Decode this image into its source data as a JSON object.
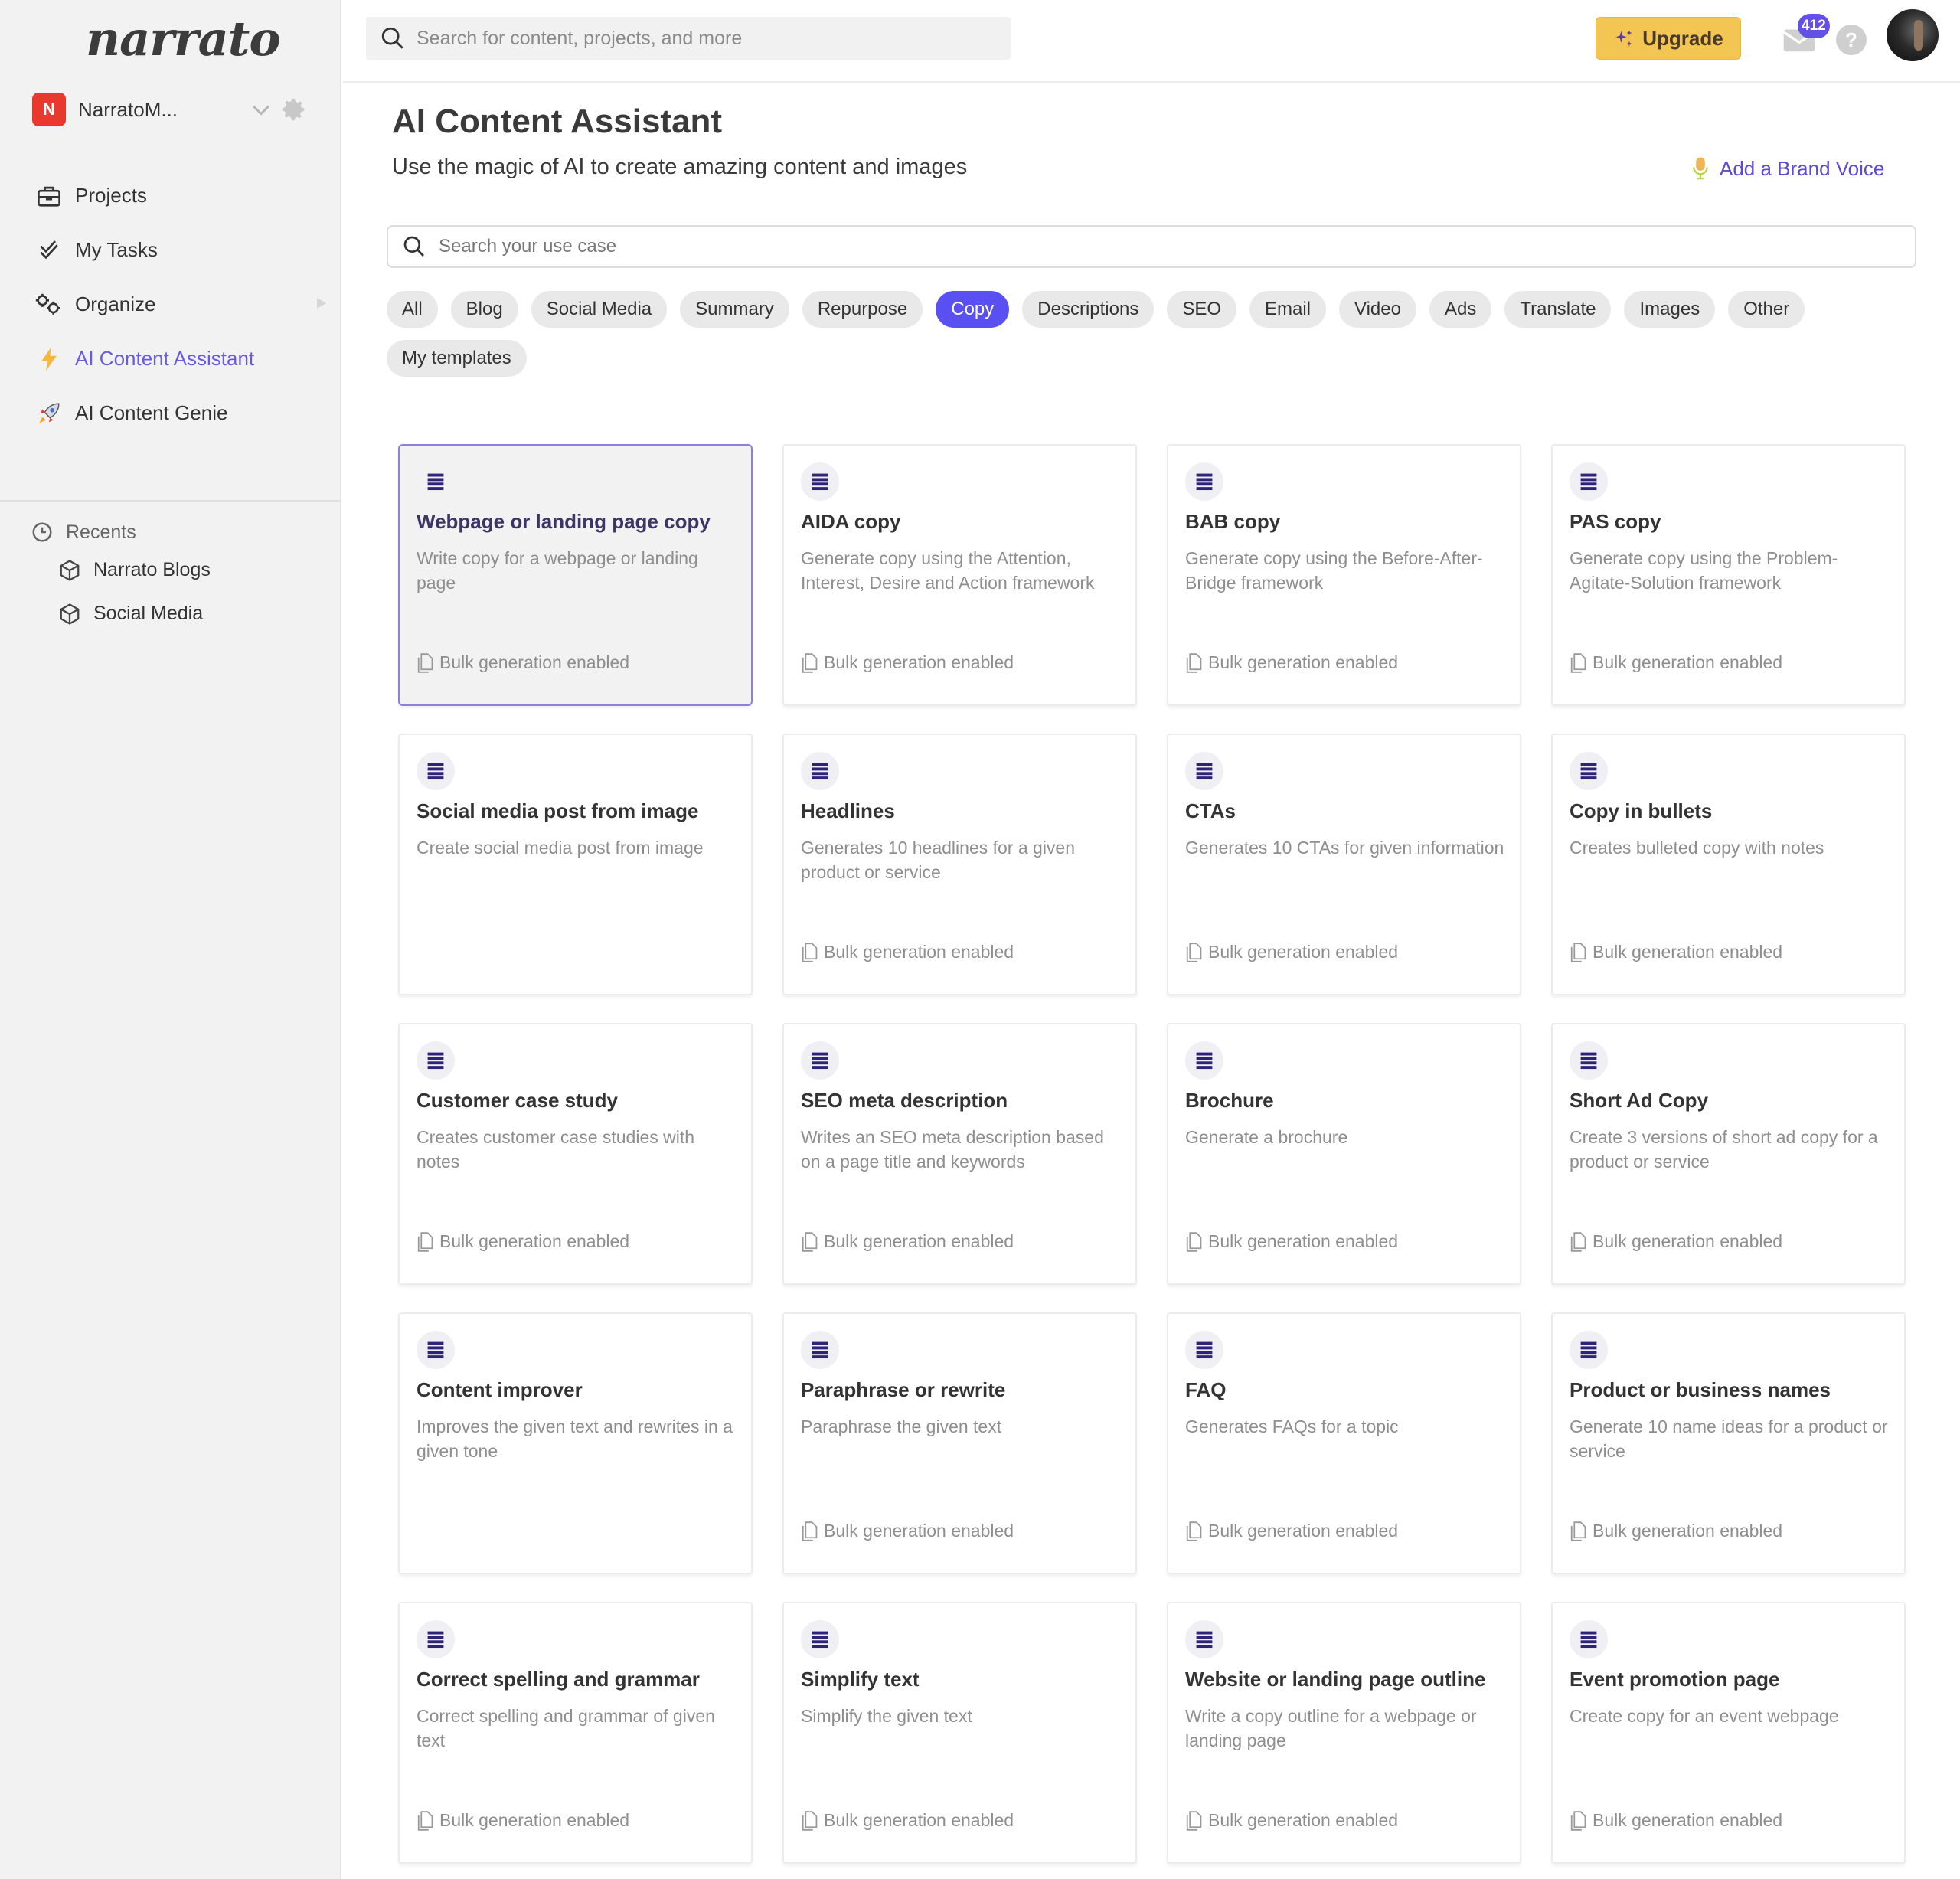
{
  "app": {
    "logo_text": "narrato",
    "workspace": {
      "badge": "N",
      "name": "NarratoM...",
      "badge_color": "#e8392f"
    }
  },
  "sidebar": {
    "items": [
      {
        "label": "Projects",
        "icon": "briefcase-icon",
        "active": false
      },
      {
        "label": "My Tasks",
        "icon": "double-check-icon",
        "active": false
      },
      {
        "label": "Organize",
        "icon": "gears-icon",
        "active": false,
        "has_submenu": true
      },
      {
        "label": "AI Content Assistant",
        "icon": "lightning-icon",
        "active": true
      },
      {
        "label": "AI Content Genie",
        "icon": "rocket-icon",
        "active": false
      }
    ],
    "recents": {
      "label": "Recents",
      "items": [
        {
          "label": "Narrato Blogs",
          "icon": "cube-icon"
        },
        {
          "label": "Social Media",
          "icon": "cube-icon"
        }
      ]
    }
  },
  "topbar": {
    "search_placeholder": "Search for content, projects, and more",
    "upgrade_label": "Upgrade",
    "notification_count": "412",
    "help_label": "?"
  },
  "main": {
    "title": "AI Content Assistant",
    "subtitle": "Use the magic of AI to create amazing content and images",
    "brand_voice_label": "Add a Brand Voice",
    "usecase_search_placeholder": "Search your use case",
    "accent_color": "#5a4ff0",
    "chips": [
      {
        "label": "All",
        "active": false
      },
      {
        "label": "Blog",
        "active": false
      },
      {
        "label": "Social Media",
        "active": false
      },
      {
        "label": "Summary",
        "active": false
      },
      {
        "label": "Repurpose",
        "active": false
      },
      {
        "label": "Copy",
        "active": true
      },
      {
        "label": "Descriptions",
        "active": false
      },
      {
        "label": "SEO",
        "active": false
      },
      {
        "label": "Email",
        "active": false
      },
      {
        "label": "Video",
        "active": false
      },
      {
        "label": "Ads",
        "active": false
      },
      {
        "label": "Translate",
        "active": false
      },
      {
        "label": "Images",
        "active": false
      },
      {
        "label": "Other",
        "active": false
      },
      {
        "label": "My templates",
        "active": false
      }
    ],
    "bulk_label": "Bulk generation enabled",
    "cards": [
      {
        "title": "Webpage or landing page copy",
        "description": "Write copy for a webpage or landing page",
        "bulk": true,
        "selected": true
      },
      {
        "title": "AIDA copy",
        "description": "Generate copy using the Attention, Interest, Desire and Action framework",
        "bulk": true
      },
      {
        "title": "BAB copy",
        "description": "Generate copy using the Before-After-Bridge framework",
        "bulk": true
      },
      {
        "title": "PAS copy",
        "description": "Generate copy using the Problem-Agitate-Solution framework",
        "bulk": true
      },
      {
        "title": "Social media post from image",
        "description": "Create social media post from image",
        "bulk": false
      },
      {
        "title": "Headlines",
        "description": "Generates 10 headlines for a given product or service",
        "bulk": true
      },
      {
        "title": "CTAs",
        "description": "Generates 10 CTAs for given information",
        "bulk": true
      },
      {
        "title": "Copy in bullets",
        "description": "Creates bulleted copy with notes",
        "bulk": true
      },
      {
        "title": "Customer case study",
        "description": "Creates customer case studies with notes",
        "bulk": true
      },
      {
        "title": "SEO meta description",
        "description": "Writes an SEO meta description based on a page title and keywords",
        "bulk": true
      },
      {
        "title": "Brochure",
        "description": "Generate a brochure",
        "bulk": true
      },
      {
        "title": "Short Ad Copy",
        "description": "Create 3 versions of short ad copy for a product or service",
        "bulk": true
      },
      {
        "title": "Content improver",
        "description": "Improves the given text and rewrites in a given tone",
        "bulk": false
      },
      {
        "title": "Paraphrase or rewrite",
        "description": "Paraphrase the given text",
        "bulk": true
      },
      {
        "title": "FAQ",
        "description": "Generates FAQs for a topic",
        "bulk": true
      },
      {
        "title": "Product or business names",
        "description": "Generate 10 name ideas for a product or service",
        "bulk": true
      },
      {
        "title": "Correct spelling and grammar",
        "description": "Correct spelling and grammar of given text",
        "bulk": true
      },
      {
        "title": "Simplify text",
        "description": "Simplify the given text",
        "bulk": true
      },
      {
        "title": "Website or landing page outline",
        "description": "Write a copy outline for a webpage or landing page",
        "bulk": true
      },
      {
        "title": "Event promotion page",
        "description": "Create copy for an event webpage",
        "bulk": true
      }
    ]
  }
}
